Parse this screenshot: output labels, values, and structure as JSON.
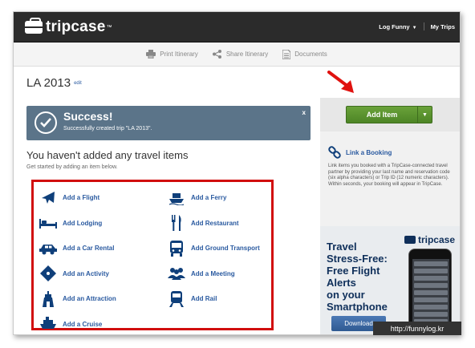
{
  "app": {
    "logo_text": "tripcase",
    "logo_mark": "™",
    "user_menu": "Log Funny",
    "my_trips": "My Trips"
  },
  "toolbar": {
    "print": "Print Itinerary",
    "share": "Share Itinerary",
    "documents": "Documents"
  },
  "trip": {
    "title": "LA 2013",
    "edit": "edit"
  },
  "success": {
    "title": "Success!",
    "message": "Successfully created trip \"LA 2013\".",
    "close": "x"
  },
  "empty": {
    "title": "You haven't added any travel items",
    "subtitle": "Get started by adding an item below."
  },
  "items": [
    {
      "label": "Add a Flight",
      "icon": "plane-icon"
    },
    {
      "label": "Add a Ferry",
      "icon": "ferry-icon"
    },
    {
      "label": "Add Lodging",
      "icon": "bed-icon"
    },
    {
      "label": "Add Restaurant",
      "icon": "fork-knife-icon"
    },
    {
      "label": "Add a Car Rental",
      "icon": "car-icon"
    },
    {
      "label": "Add Ground Transport",
      "icon": "bus-icon"
    },
    {
      "label": "Add an Activity",
      "icon": "ticket-icon"
    },
    {
      "label": "Add a Meeting",
      "icon": "people-icon"
    },
    {
      "label": "Add an Attraction",
      "icon": "landmark-icon"
    },
    {
      "label": "Add Rail",
      "icon": "train-icon"
    },
    {
      "label": "Add a Cruise",
      "icon": "ship-icon"
    }
  ],
  "add_item": {
    "label": "Add Item",
    "dropdown": "▼"
  },
  "link_booking": {
    "title": "Link a Booking",
    "description": "Link items you booked with a TripCase-connected travel partner by providing your last name and reservation code (six alpha characters) or Trip ID (12 numeric characters). Within seconds, your booking will appear in TripCase."
  },
  "promo": {
    "logo": "tripcase",
    "line1": "Travel",
    "line2": "Stress-Free:",
    "line3": "Free Flight",
    "line4": "Alerts",
    "line5": "on your",
    "line6": "Smartphone",
    "download": "Download"
  },
  "watermark": "http://funnylog.kr",
  "colors": {
    "header": "#2b2b2b",
    "success": "#5b7489",
    "link": "#2a5aa0",
    "highlight_border": "#d10d0d",
    "add_button": "#5a9230",
    "promo_text": "#0f2f5a"
  }
}
